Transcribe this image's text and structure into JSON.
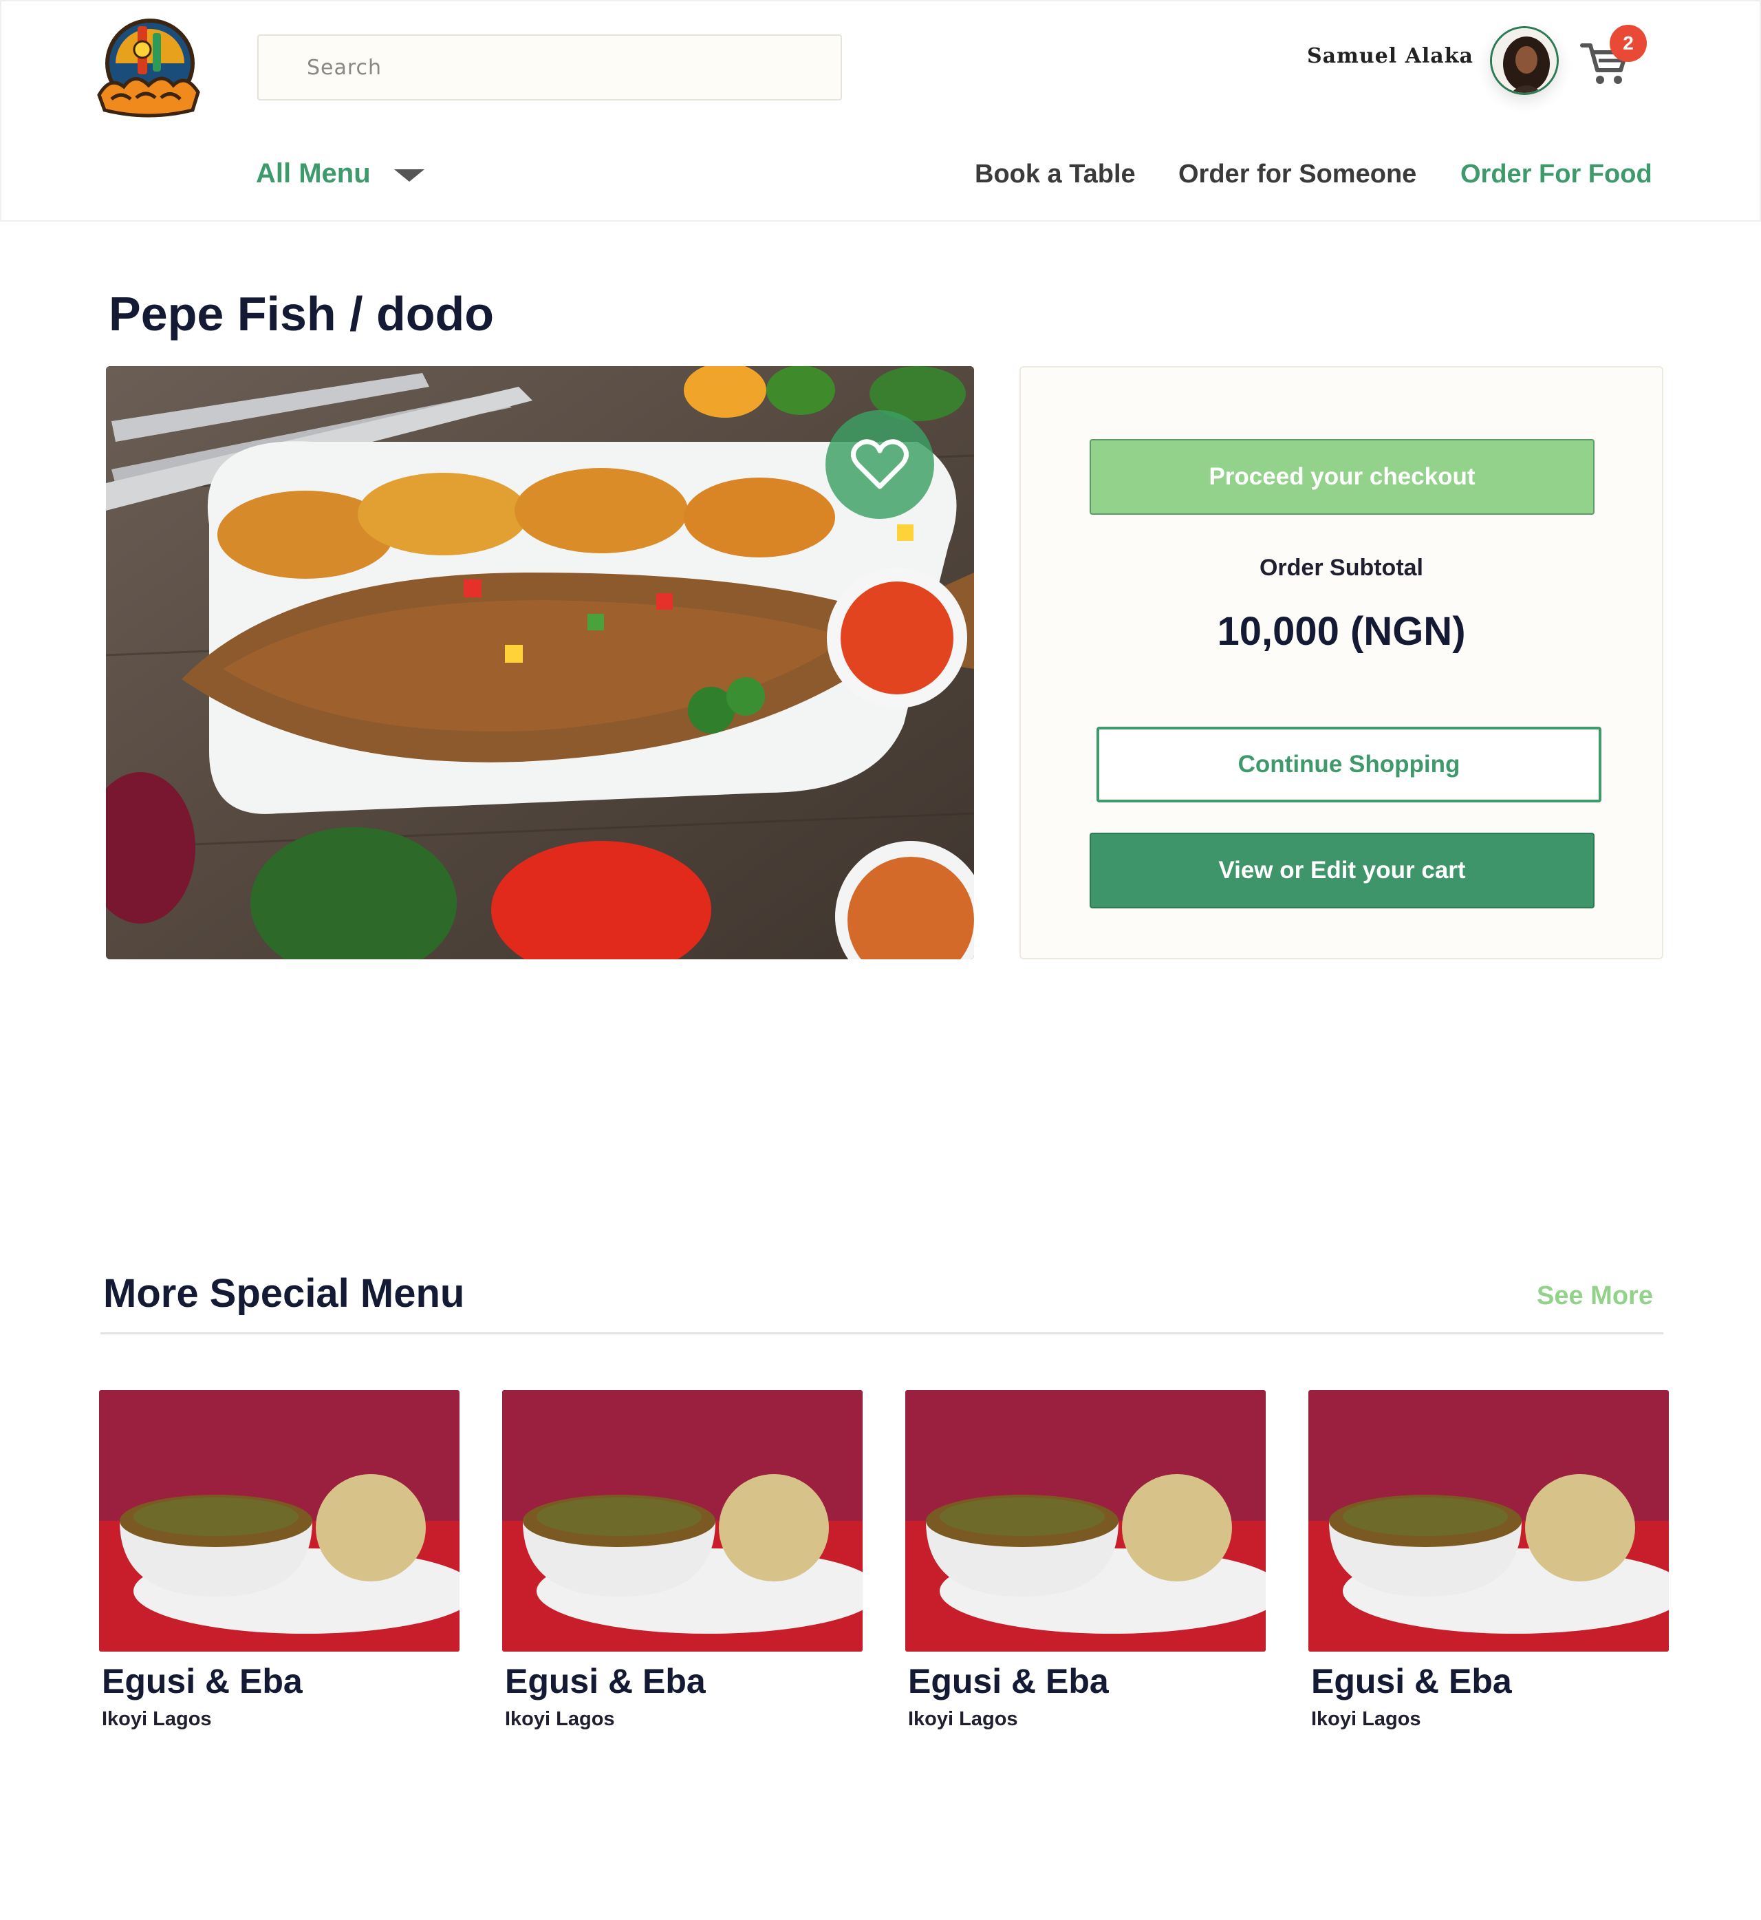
{
  "header": {
    "search_placeholder": "Search",
    "username": "Samuel Alaka",
    "cart_count": "2"
  },
  "nav": {
    "all_menu": "All Menu",
    "links": [
      "Book a Table",
      "Order for Someone",
      "Order For Food"
    ]
  },
  "product": {
    "title": "Pepe Fish / dodo"
  },
  "panel": {
    "proceed_label": "Proceed your checkout",
    "subtotal_label": "Order Subtotal",
    "subtotal_value": "10,000 (NGN)",
    "continue_label": "Continue Shopping",
    "view_cart_label": "View or Edit your cart"
  },
  "more": {
    "title": "More Special Menu",
    "see_more": "See More",
    "items": [
      {
        "name": "Egusi & Eba",
        "location": "Ikoyi Lagos"
      },
      {
        "name": "Egusi & Eba",
        "location": "Ikoyi Lagos"
      },
      {
        "name": "Egusi & Eba",
        "location": "Ikoyi Lagos"
      },
      {
        "name": "Egusi & Eba",
        "location": "Ikoyi Lagos"
      }
    ]
  },
  "colors": {
    "brand_green": "#3f9a6b",
    "light_green": "#93d28a",
    "badge_red": "#e94a35",
    "title_navy": "#141a33"
  },
  "icons": [
    "brand-logo",
    "shopping-cart-icon",
    "heart-icon",
    "chevron-down-icon"
  ]
}
